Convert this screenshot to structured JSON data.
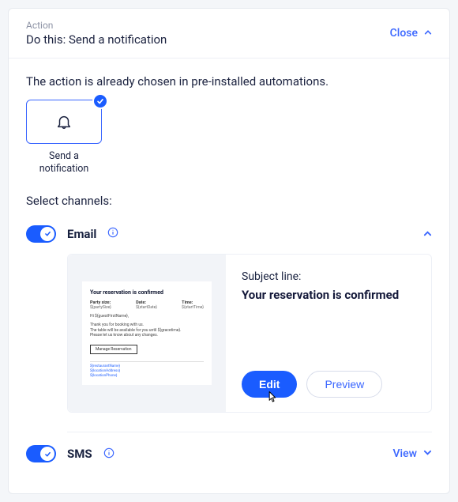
{
  "header": {
    "eyebrow": "Action",
    "title": "Do this: Send a notification",
    "close_label": "Close"
  },
  "intro": "The action is already chosen in pre-installed automations.",
  "action_tile": {
    "label": "Send a\nnotification"
  },
  "section_label": "Select channels:",
  "channels": {
    "email": {
      "name": "Email",
      "subject_label": "Subject line:",
      "subject_value": "Your reservation is confirmed",
      "edit_label": "Edit",
      "preview_label": "Preview",
      "preview_content": {
        "title": "Your reservation is confirmed",
        "col1_h": "Party size:",
        "col1_v": "${partySize}",
        "col2_h": "Date:",
        "col2_v": "${startDate}",
        "col3_h": "Time:",
        "col3_v": "${startTime}",
        "greeting": "Hi ${guestFirstName},",
        "body": "Thank you for booking with us.\nThe table will be available for you until ${gracetime}.\nPlease let us know about any changes.",
        "button": "Manage Reservation",
        "f1": "${restaurantName}",
        "f2": "${locationAddress}",
        "f3": "${locationPhone}"
      }
    },
    "sms": {
      "name": "SMS",
      "view_label": "View"
    }
  }
}
